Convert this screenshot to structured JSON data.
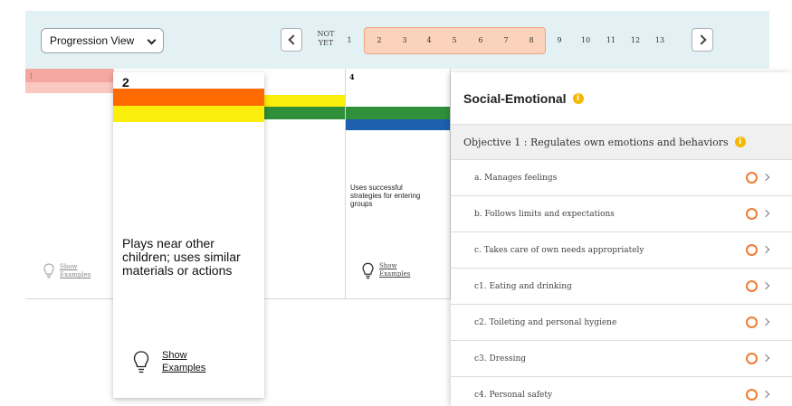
{
  "toolbar": {
    "view_select": "Progression View",
    "not_yet": "NOT YET",
    "levels": [
      "1",
      "2",
      "3",
      "4",
      "5",
      "6",
      "7",
      "8",
      "9",
      "10",
      "11",
      "12",
      "13"
    ],
    "selected_range": [
      "2",
      "8"
    ]
  },
  "grid": {
    "col1_number": "1",
    "col4_number": "4",
    "col4_description": "Uses successful strategies for entering groups",
    "show_examples": "Show Examples"
  },
  "card": {
    "number": "2",
    "description": "Plays near other children; uses similar materials or actions",
    "show_examples": "Show Examples"
  },
  "panel": {
    "title": "Social-Emotional",
    "objective": "Objective 1 : Regulates own emotions and behaviors",
    "items": [
      "a. Manages feelings",
      "b. Follows limits and expectations",
      "c. Takes care of own needs appropriately",
      "c1. Eating and drinking",
      "c2. Toileting and personal hygiene",
      "c3. Dressing",
      "c4. Personal safety"
    ]
  },
  "colors": {
    "topbar_bg": "#e3f1f5",
    "range_highlight": "#fbd3bd",
    "band_pink": "#f4a6a0",
    "band_orange": "#ff6a00",
    "band_yellow": "#fbee0a",
    "band_green": "#2f8f3a",
    "band_blue": "#1e5fae",
    "status_ring": "#f07c33",
    "info_icon": "#f5b800"
  }
}
